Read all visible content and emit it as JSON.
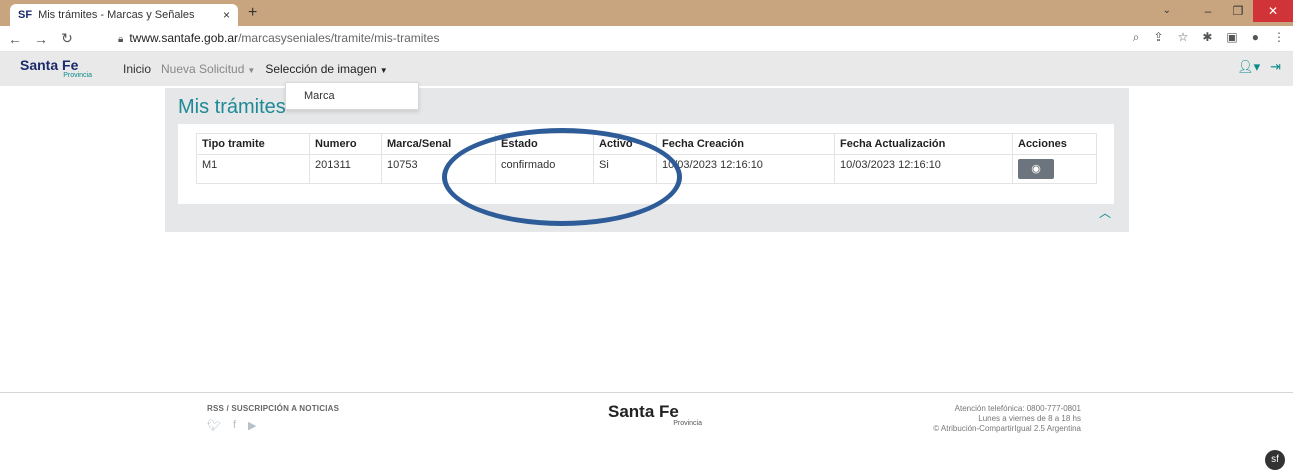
{
  "browser": {
    "tab_favicon": "SF",
    "tab_title": "Mis trámites - Marcas y Señales",
    "tab_close": "×",
    "new_tab": "+",
    "url_host": "twww.santafe.gob.ar",
    "url_path": "/marcasyseniales/tramite/mis-tramites"
  },
  "navbar": {
    "brand_main": "Santa Fe",
    "brand_sub": "Provincia",
    "inicio": "Inicio",
    "nueva_solicitud": "Nueva Solicitud",
    "seleccion_imagen": "Selección de imagen"
  },
  "dropdown": {
    "items": [
      "Marca"
    ]
  },
  "main": {
    "title": "Mis trámites",
    "table": {
      "headers": [
        "Tipo tramite",
        "Numero",
        "Marca/Senal",
        "Estado",
        "Activo",
        "Fecha Creación",
        "Fecha Actualización",
        "Acciones"
      ],
      "rows": [
        [
          "M1",
          "201311",
          "10753",
          "confirmado",
          "Si",
          "10/03/2023 12:16:10",
          "10/03/2023 12:16:10"
        ]
      ]
    }
  },
  "footer": {
    "rss": "RSS / SUSCRIPCIÓN A NOTICIAS",
    "brand_main": "Santa Fe",
    "brand_sub": "Provincia",
    "phone": "Atención telefónica: 0800-777-0801",
    "hours": "Lunes a viernes de 8 a 18 hs",
    "license": "© Atribución-CompartirIgual 2.5 Argentina"
  },
  "icons": {
    "annotation_color": "#2e5c98",
    "accent_color": "#1e8a96"
  }
}
